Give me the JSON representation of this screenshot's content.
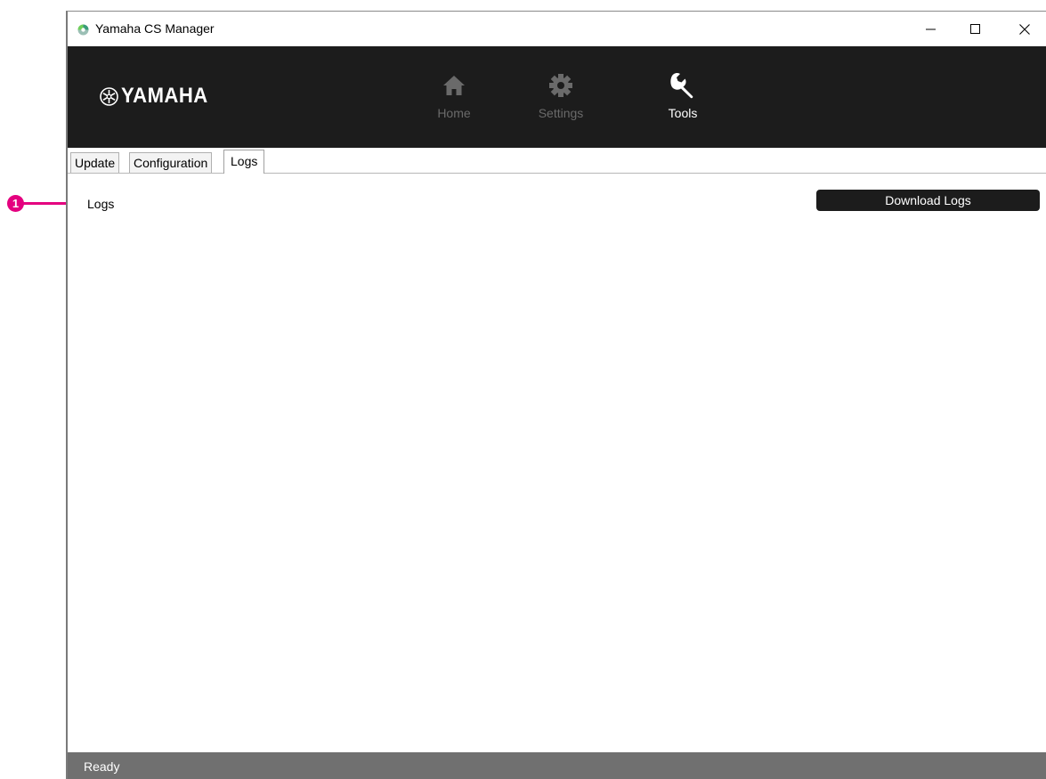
{
  "annotation": {
    "number": "1"
  },
  "window": {
    "title": "Yamaha CS Manager",
    "controls": {
      "minimize": "minimize-icon",
      "maximize": "maximize-icon",
      "close": "close-icon"
    }
  },
  "header": {
    "logo_text": "YAMAHA",
    "nav": [
      {
        "label": "Home",
        "icon": "home-icon",
        "active": false
      },
      {
        "label": "Settings",
        "icon": "gear-icon",
        "active": false
      },
      {
        "label": "Tools",
        "icon": "wrench-icon",
        "active": true
      }
    ]
  },
  "tabs": [
    {
      "label": "Update",
      "selected": false
    },
    {
      "label": "Configuration",
      "selected": false
    },
    {
      "label": "Logs",
      "selected": true
    }
  ],
  "main": {
    "section_label": "Logs",
    "download_button": "Download Logs"
  },
  "status": {
    "text": "Ready"
  },
  "colors": {
    "header_bg": "#1c1c1c",
    "accent": "#e4007f",
    "status_bg": "#707070",
    "nav_inactive": "#6a6a6a"
  }
}
